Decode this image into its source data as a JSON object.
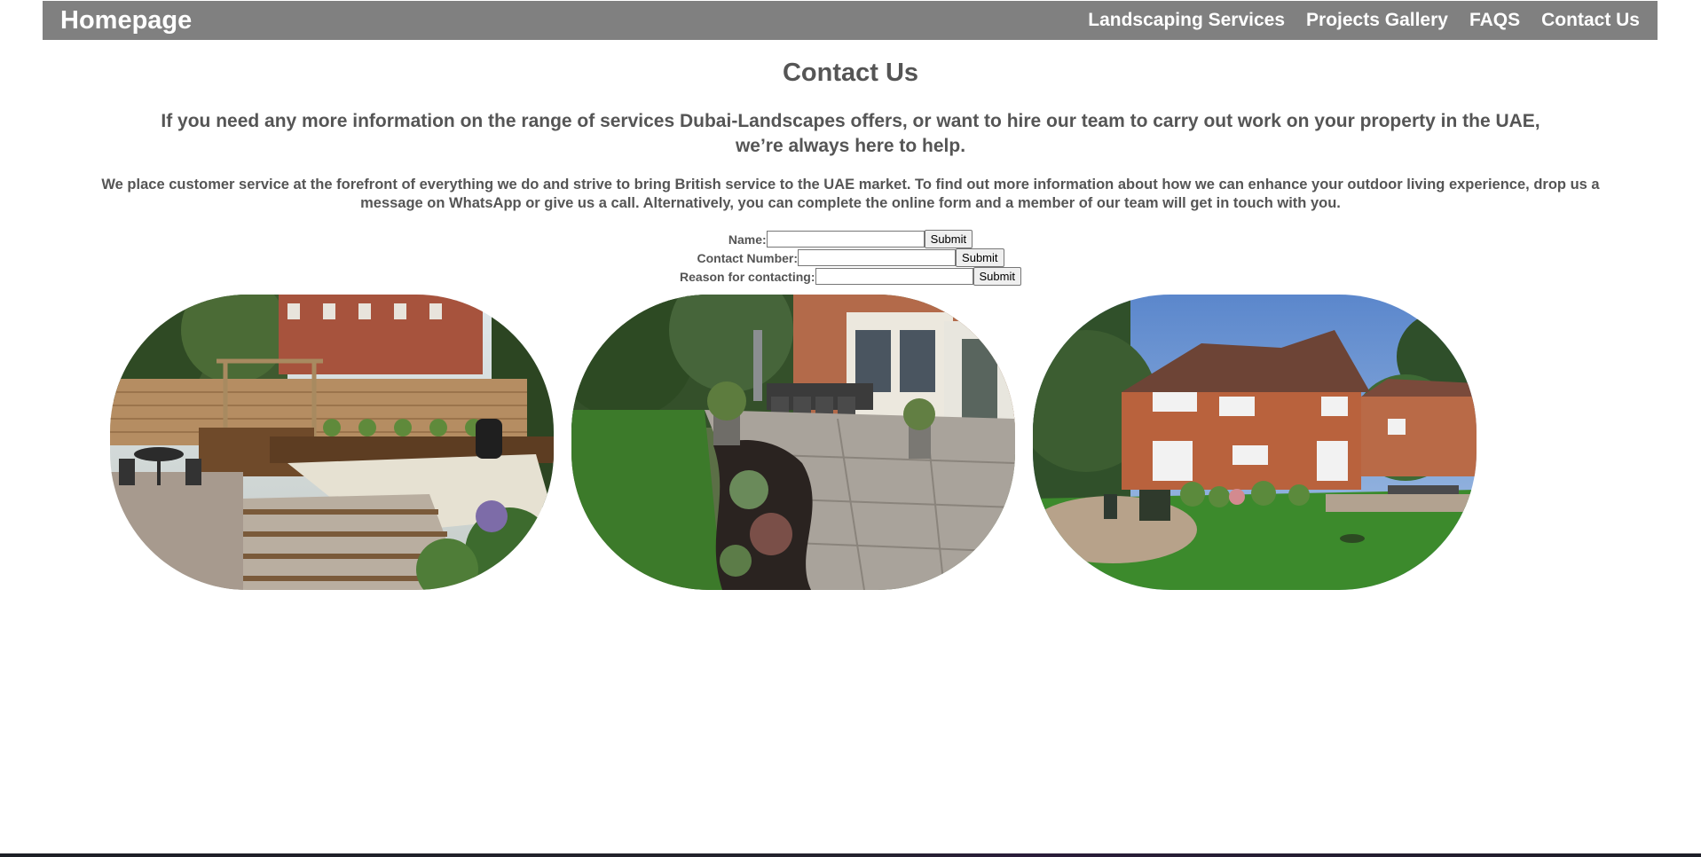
{
  "nav": {
    "brand": "Homepage",
    "links": [
      "Landscaping Services",
      "Projects Gallery",
      "FAQS",
      "Contact Us"
    ]
  },
  "page": {
    "title": "Contact Us",
    "subheading": "If you need any more information on the range of services Dubai-Landscapes offers, or want to hire our team to carry out work on your property in the UAE, we’re always here to help.",
    "intro": "We place customer service at the forefront of everything we do and strive to bring British service to the UAE market. To find out more information about how we can enhance your outdoor living experience, drop us a message on WhatsApp or give us a call. Alternatively, you can complete the online form and a member of our team will get in touch with you."
  },
  "form": {
    "fields": [
      {
        "label": "Name:",
        "value": "",
        "button": "Submit"
      },
      {
        "label": "Contact Number:",
        "value": "",
        "button": "Submit"
      },
      {
        "label": "Reason for contacting:",
        "value": "",
        "button": "Submit"
      }
    ]
  },
  "gallery": {
    "images": [
      {
        "icon": "garden-steps-patio-image"
      },
      {
        "icon": "garden-lawn-patio-image"
      },
      {
        "icon": "house-garden-image"
      }
    ]
  },
  "colors": {
    "navbar": "#808080",
    "text": "#555555",
    "nav_text": "#ffffff"
  }
}
